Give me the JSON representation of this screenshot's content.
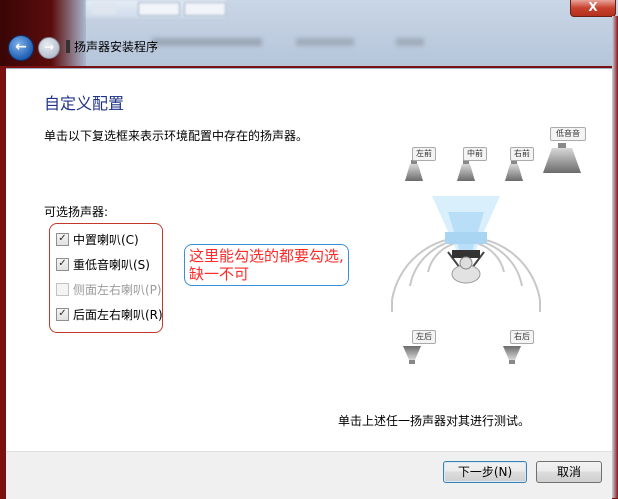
{
  "background_window": {
    "close_label": "X"
  },
  "header": {
    "back_icon": "←",
    "forward_icon": "→",
    "title": "扬声器安装程序"
  },
  "main": {
    "section_title": "自定义配置",
    "instruction": "单击以下复选框来表示环境配置中存在的扬声器。",
    "group_label": "可选扬声器:",
    "checkboxes": [
      {
        "label": "中置喇叭(C)",
        "checked": true,
        "enabled": true
      },
      {
        "label": "重低音喇叭(S)",
        "checked": true,
        "enabled": true
      },
      {
        "label": "侧面左右喇叭(P)",
        "checked": false,
        "enabled": false
      },
      {
        "label": "后面左右喇叭(R)",
        "checked": true,
        "enabled": true
      }
    ],
    "annotation": "这里能勾选的都要勾选,缺一不可",
    "check_mark": "✓"
  },
  "diagram": {
    "labels": {
      "front_left": "左前",
      "center": "中前",
      "front_right": "右前",
      "subwoofer": "低音音",
      "rear_left": "左后",
      "rear_right": "右后"
    },
    "test_text": "单击上述任一扬声器对其进行测试。"
  },
  "footer": {
    "next_label": "下一步(N)",
    "cancel_label": "取消"
  }
}
